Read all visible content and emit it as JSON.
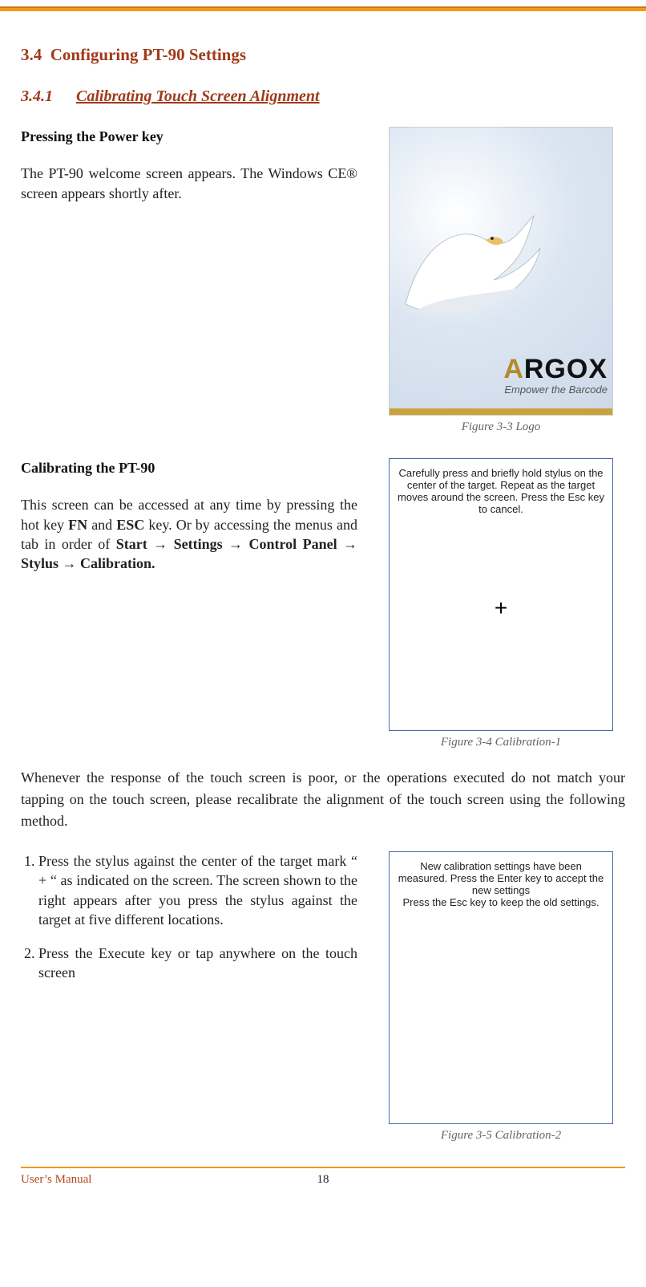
{
  "header_rule_color": "#f39a1f",
  "sections": {
    "sec_number": "3.4",
    "sec_title": "Configuring PT-90 Settings",
    "sub_number": "3.4.1",
    "sub_title": "Calibrating Touch Screen Alignment"
  },
  "block1": {
    "heading": "Pressing the Power key",
    "text": "The PT-90 welcome screen appears. The Windows CE® screen appears shortly after.",
    "logo_brand_a": "A",
    "logo_brand_rest": "RGOX",
    "logo_tagline": "Empower the Barcode",
    "caption": "Figure 3-3 Logo"
  },
  "block2": {
    "heading": "Calibrating the PT-90",
    "text_pre": "This screen can be accessed at any time by pressing the hot key ",
    "fn": "FN",
    "text_mid1": " and ",
    "esc": "ESC",
    "text_mid2": " key. Or by accessing the menus and tab in order of  ",
    "path_start": "Start",
    "arrow": "→",
    "path_settings": "Settings",
    "path_cp": "Control Panel",
    "path_stylus": "Stylus",
    "path_cal": "Calibration.",
    "screen_text": "Carefully press and briefly hold stylus on the center of the target. Repeat as the target moves around the screen. Press the Esc key to cancel.",
    "crosshair": "+",
    "caption": "Figure 3-4 Calibration-1"
  },
  "para_full": "Whenever the response of the touch screen is poor, or the operations executed do not match your tapping on the touch screen, please recalibrate the alignment of the touch screen using the following method.",
  "block3": {
    "step1": "Press the stylus against the center of the target mark “ + “ as indicated on the screen. The screen shown to the right appears after you press the stylus against the target at five different locations.",
    "step2": "Press the Execute key or tap anywhere on the touch screen",
    "screen_text": "New calibration settings have been measured. Press the Enter key to accept the new settings\nPress the Esc key to keep the old settings.",
    "caption": "Figure 3-5 Calibration-2"
  },
  "footer": {
    "left": "User’s Manual",
    "page": "18"
  }
}
